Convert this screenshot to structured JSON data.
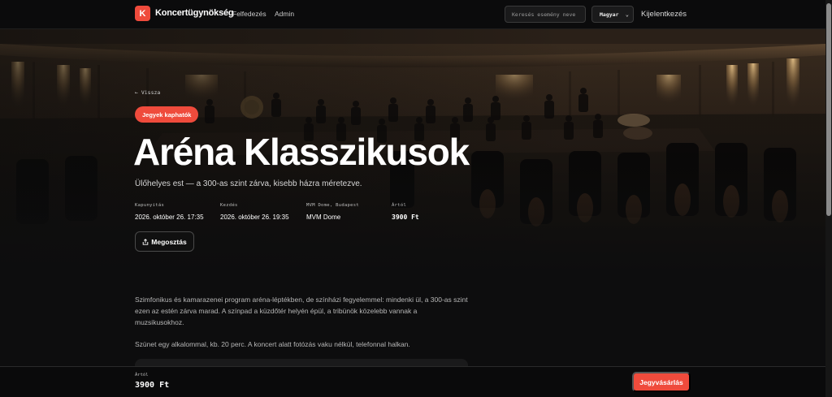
{
  "header": {
    "logo_letter": "K",
    "brand": "Koncertügynökség",
    "nav": [
      {
        "label": "Felfedezés"
      },
      {
        "label": "Admin"
      }
    ],
    "search_placeholder": "Keresés esemény neve",
    "language": "Magyar",
    "logout": "Kijelentkezés"
  },
  "event": {
    "back": "← Vissza",
    "badge": "Jegyek kaphatók",
    "title": "Aréna Klasszikusok",
    "subtitle": "Ülőhelyes est — a 300-as szint zárva, kisebb házra méretezve.",
    "meta": [
      {
        "label": "Kapunyitás",
        "value": "2026. október 26. 17:35"
      },
      {
        "label": "Kezdés",
        "value": "2026. október 26. 19:35"
      },
      {
        "label": "MVM Dome, Budapest",
        "value": "MVM Dome"
      },
      {
        "label": "Ártól",
        "value": "3900 Ft"
      }
    ],
    "share": "Megosztás",
    "description": [
      "Szimfonikus és kamarazenei program aréna-léptékben, de színházi fegyelemmel: mindenki ül, a 300-as szint ezen az estén zárva marad. A színpad a küzdőtér helyén épül, a tribünök közelebb vannak a muzsikusokhoz.",
      "Szünet egy alkalommal, kb. 20 perc. A koncert alatt fotózás vaku nélkül, telefonnal halkan."
    ]
  },
  "bottom_bar": {
    "price_label": "Ártól",
    "price": "3900 Ft",
    "buy": "Jegyvásárlás"
  },
  "colors": {
    "accent": "#ef4b3c",
    "background": "#0d0d0e"
  },
  "icons": [
    "share-icon",
    "chevron-down-icon"
  ]
}
